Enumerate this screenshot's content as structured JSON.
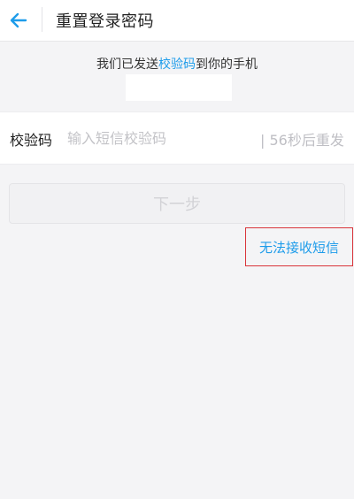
{
  "header": {
    "back_icon": "arrow-left-icon",
    "title": "重置登录密码"
  },
  "notice": {
    "prefix": "我们已发送",
    "highlight": "校验码",
    "suffix": "到你的手机"
  },
  "code_row": {
    "label": "校验码",
    "placeholder": "输入短信校验码",
    "resend_text": "| 56秒后重发"
  },
  "next_button": {
    "label": "下一步"
  },
  "cant_receive": {
    "label": "无法接收短信"
  },
  "colors": {
    "accent": "#1e9cea",
    "highlight_box": "#d9343a",
    "background": "#f4f4f6"
  }
}
